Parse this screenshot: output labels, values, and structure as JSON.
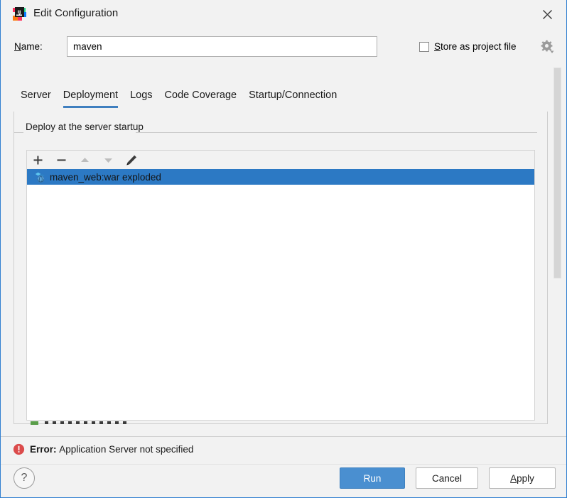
{
  "window": {
    "title": "Edit Configuration",
    "app_icon": "intellij-idea-icon",
    "close_icon": "close-icon"
  },
  "name_row": {
    "label_prefix": "N",
    "label_rest": "ame:",
    "value": "maven",
    "placeholder": "",
    "store_as_project_file": {
      "label_prefix": "S",
      "label_rest": "tore as project file",
      "checked": false
    },
    "gear_icon": "gear-icon"
  },
  "tabs": [
    {
      "label": "Server",
      "active": false
    },
    {
      "label": "Deployment",
      "active": true
    },
    {
      "label": "Logs",
      "active": false
    },
    {
      "label": "Code Coverage",
      "active": false
    },
    {
      "label": "Startup/Connection",
      "active": false
    }
  ],
  "deployment": {
    "group_title": "Deploy at the server startup",
    "toolbar": [
      {
        "name": "add-button",
        "icon": "plus-icon",
        "enabled": true
      },
      {
        "name": "remove-button",
        "icon": "minus-icon",
        "enabled": true
      },
      {
        "name": "move-up-button",
        "icon": "arrow-up-icon",
        "enabled": false
      },
      {
        "name": "move-down-button",
        "icon": "arrow-down-icon",
        "enabled": false
      },
      {
        "name": "edit-button",
        "icon": "pencil-icon",
        "enabled": true
      }
    ],
    "items": [
      {
        "label": "maven_web:war exploded",
        "icon": "artifact-icon",
        "selected": true
      }
    ]
  },
  "error": {
    "icon": "error-icon",
    "prefix": "Error:",
    "message": "Application Server not specified"
  },
  "footer": {
    "help_label": "?",
    "run_label": "Run",
    "cancel_label": "Cancel",
    "apply_prefix": "A",
    "apply_rest": "pply"
  },
  "colors": {
    "selection_blue": "#2c79c4",
    "primary_button_blue": "#4a8fd0",
    "tab_underline_blue": "#3f7fbf",
    "window_border_blue": "#2f7fd0",
    "error_red": "#db4b4b",
    "panel_background": "#f2f2f2"
  }
}
